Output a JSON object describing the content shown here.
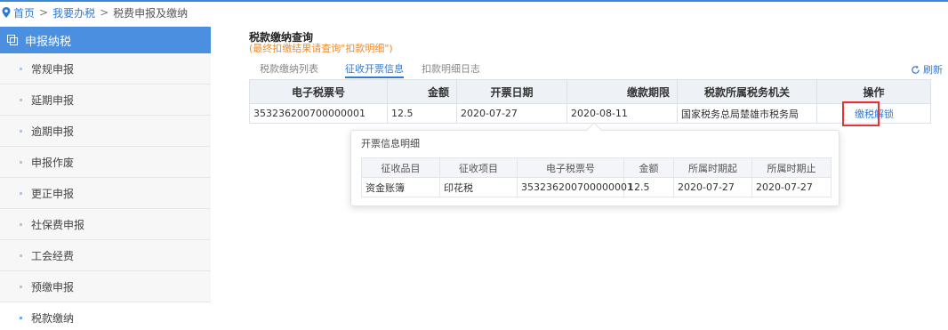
{
  "breadcrumb": {
    "home": "首页",
    "sep1": ">",
    "level2": "我要办税",
    "sep2": ">",
    "current": "税费申报及缴纳"
  },
  "sidebar": {
    "header": "申报纳税",
    "items": [
      {
        "label": "常规申报"
      },
      {
        "label": "延期申报"
      },
      {
        "label": "逾期申报"
      },
      {
        "label": "申报作废"
      },
      {
        "label": "更正申报"
      },
      {
        "label": "社保费申报"
      },
      {
        "label": "工会经费"
      },
      {
        "label": "预缴申报"
      },
      {
        "label": "税款缴纳"
      }
    ]
  },
  "main": {
    "title": "税款缴纳查询",
    "hint": "(最终扣缴结果请查询\"扣款明细\")",
    "tabs": [
      {
        "label": "税款缴纳列表"
      },
      {
        "label": "征收开票信息"
      },
      {
        "label": "扣款明细日志"
      }
    ],
    "refresh": "刷新",
    "table": {
      "headers": [
        "电子税票号",
        "金额",
        "开票日期",
        "缴款期限",
        "税款所属税务机关",
        "操作"
      ],
      "row": {
        "ticket_no": "353236200700000001",
        "amount": "12.5",
        "issue_date": "2020-07-27",
        "deadline": "2020-08-11",
        "authority": "国家税务总局楚雄市税务局",
        "pay": "缴税",
        "unlock": "解锁"
      }
    }
  },
  "popup": {
    "title": "开票信息明细",
    "headers": [
      "征收品目",
      "征收项目",
      "电子税票号",
      "金额",
      "所属时期起",
      "所属时期止"
    ],
    "row": [
      "资金账簿",
      "印花税",
      "353236200700000001",
      "12.5",
      "2020-07-27",
      "2020-07-27"
    ]
  },
  "colors": {
    "accent": "#4a8fe0",
    "link": "#2f7ad6",
    "hint": "#f08a24",
    "highlight": "#e53333"
  }
}
